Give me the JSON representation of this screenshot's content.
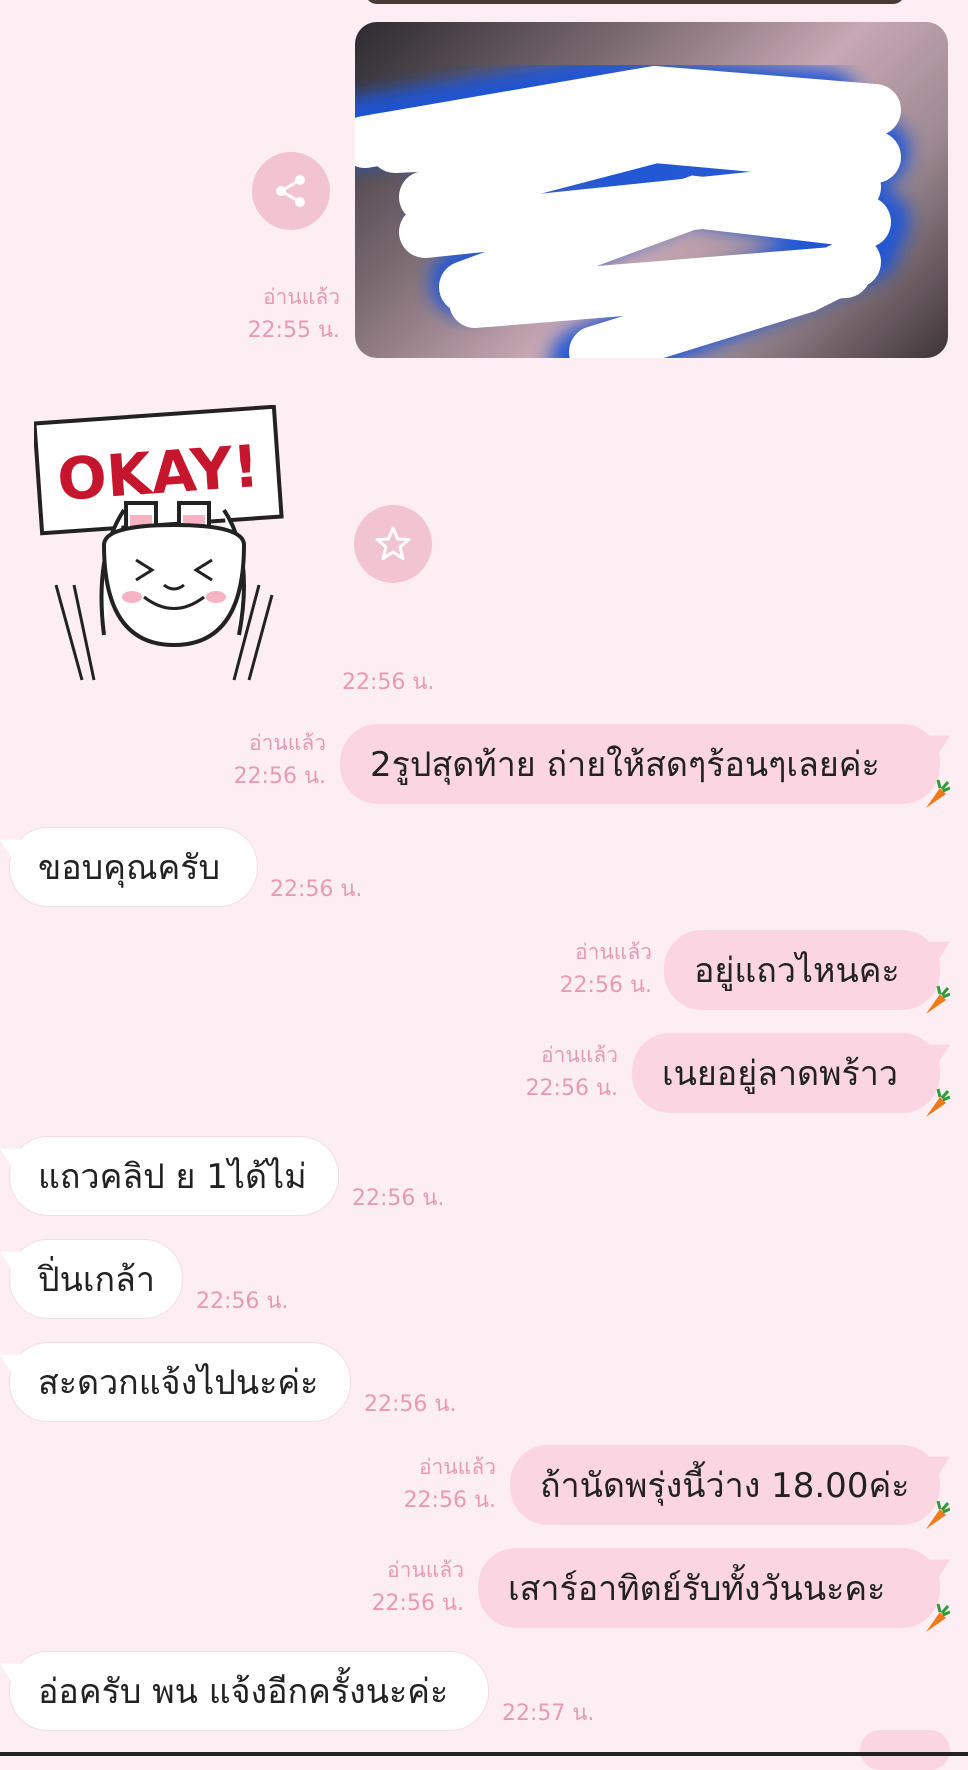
{
  "colors": {
    "background": "#fdeef3",
    "outgoing_bubble": "#fbd6e2",
    "incoming_bubble": "#ffffff",
    "meta_text": "#e79ab2"
  },
  "photo_message": {
    "read": "อ่านแล้ว",
    "time": "22:55 น.",
    "share_icon": "share-icon"
  },
  "sticker_message": {
    "sticker_text": "OKAY!",
    "time": "22:56 น.",
    "favorite_icon": "star-icon"
  },
  "messages": [
    {
      "dir": "out",
      "text": "2รูปสุดท้าย ถ่ายให้สดๆร้อนๆเลยค่ะ",
      "read": "อ่านแล้ว",
      "time": "22:56 น."
    },
    {
      "dir": "in",
      "text": "ขอบคุณครับ",
      "time": "22:56 น."
    },
    {
      "dir": "out",
      "text": "อยู่แถวไหนคะ",
      "read": "อ่านแล้ว",
      "time": "22:56 น."
    },
    {
      "dir": "out",
      "text": "เนยอยู่ลาดพร้าว",
      "read": "อ่านแล้ว",
      "time": "22:56 น."
    },
    {
      "dir": "in",
      "text": "แถวคลิป ย 1ได้ไม่",
      "time": "22:56 น."
    },
    {
      "dir": "in",
      "text": "ปิ่นเกล้า",
      "time": "22:56 น."
    },
    {
      "dir": "in",
      "text": "สะดวกแจ้งไปนะค่ะ",
      "time": "22:56 น."
    },
    {
      "dir": "out",
      "text": "ถ้านัดพรุ่งนี้ว่าง 18.00ค่ะ",
      "read": "อ่านแล้ว",
      "time": "22:56 น."
    },
    {
      "dir": "out",
      "text": "เสาร์อาทิตย์รับทั้งวันนะคะ",
      "read": "อ่านแล้ว",
      "time": "22:56 น."
    },
    {
      "dir": "in",
      "text": "อ่อครับ พน แจ้งอีกครั้งนะค่ะ",
      "time": "22:57 น."
    }
  ]
}
